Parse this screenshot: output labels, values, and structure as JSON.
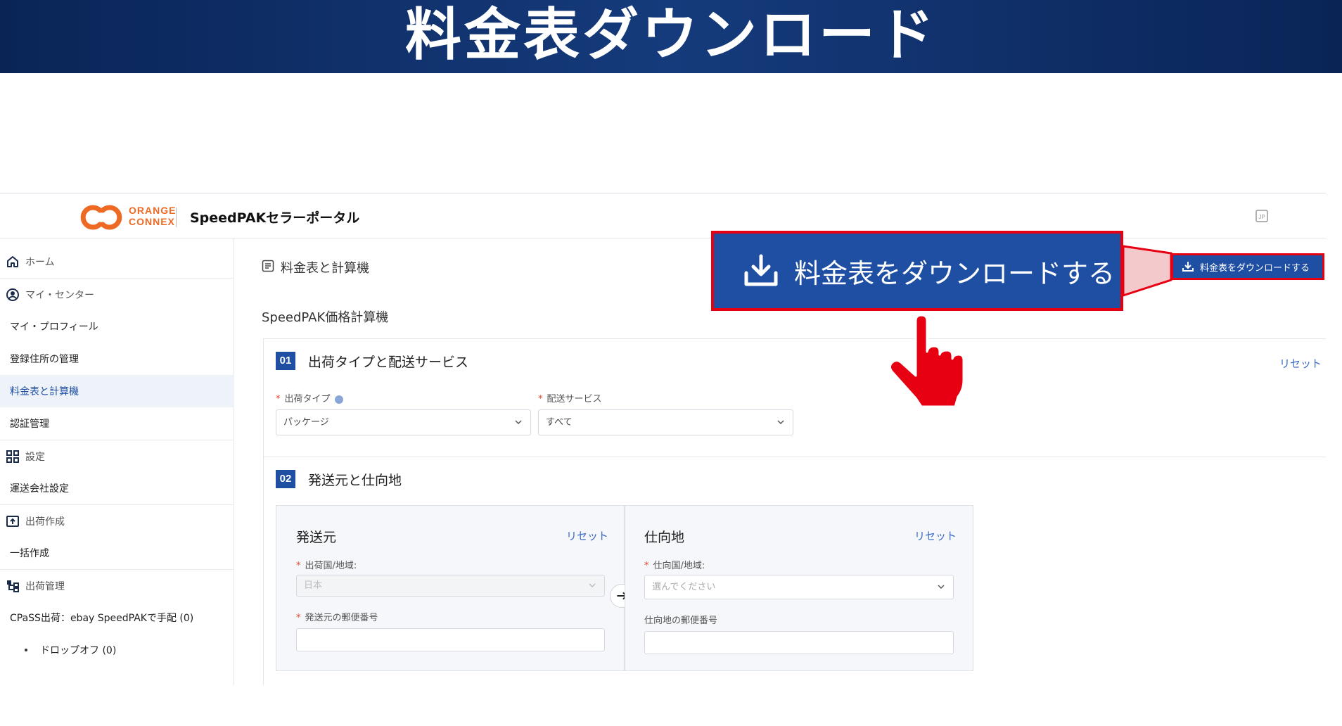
{
  "slide": {
    "title": "料金表ダウンロード"
  },
  "header": {
    "logo_text_line1": "ORANGE",
    "logo_text_line2": "CONNEX",
    "portal_title": "SpeedPAKセラーポータル",
    "lang_icon": "JP"
  },
  "sidebar": {
    "items": [
      {
        "label": "ホーム",
        "icon": "home-icon",
        "type": "group"
      },
      {
        "label": "マイ・センター",
        "icon": "user-circle-icon",
        "type": "group"
      },
      {
        "label": "マイ・プロフィール",
        "type": "sub"
      },
      {
        "label": "登録住所の管理",
        "type": "sub"
      },
      {
        "label": "料金表と計算機",
        "type": "sub",
        "active": true
      },
      {
        "label": "認証管理",
        "type": "sub"
      },
      {
        "label": "設定",
        "icon": "grid-icon",
        "type": "group"
      },
      {
        "label": "運送会社設定",
        "type": "sub"
      },
      {
        "label": "出荷作成",
        "icon": "upload-box-icon",
        "type": "group"
      },
      {
        "label": "一括作成",
        "type": "sub"
      },
      {
        "label": "出荷管理",
        "icon": "flow-icon",
        "type": "group"
      },
      {
        "label": "CPaSS出荷：ebay SpeedPAKで手配 (0)",
        "type": "sub"
      },
      {
        "label": "ドロップオフ (0)",
        "type": "bullet"
      }
    ]
  },
  "main": {
    "breadcrumb": "料金表と計算機",
    "calculator_title": "SpeedPAK価格計算機",
    "download_button": "料金表をダウンロードする",
    "step1": {
      "number": "01",
      "title": "出荷タイプと配送サービス",
      "reset": "リセット",
      "shipment_type_label": "出荷タイプ",
      "shipment_type_value": "パッケージ",
      "service_label": "配送サービス",
      "service_value": "すべて"
    },
    "step2": {
      "number": "02",
      "title": "発送元と仕向地",
      "origin": {
        "heading": "発送元",
        "reset": "リセット",
        "country_label": "出荷国/地域:",
        "country_value": "日本",
        "postal_label": "発送元の郵便番号"
      },
      "destination": {
        "heading": "仕向地",
        "reset": "リセット",
        "country_label": "仕向国/地域:",
        "country_placeholder": "選んでください",
        "postal_label": "仕向地の郵便番号"
      }
    }
  },
  "callout": {
    "label": "料金表をダウンロードする"
  },
  "colors": {
    "primary": "#1f4fa3",
    "highlight": "#e60012",
    "brand_orange": "#ee6a24"
  }
}
